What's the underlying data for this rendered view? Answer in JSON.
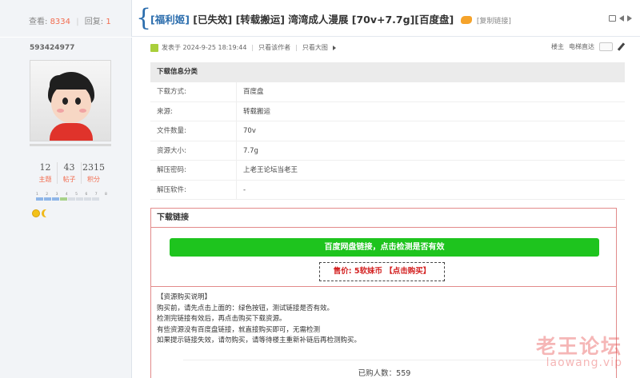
{
  "header": {
    "views_label": "查看:",
    "views_value": "8334",
    "replies_label": "回复:",
    "replies_value": "1",
    "title_tag1": "[福利姬]",
    "title_tag2": "[已失效]",
    "title_tag3": "[转载搬运]",
    "title_main": "湾湾成人漫展 [70v+7.7g][百度盘]",
    "copy_link": "[复制链接]"
  },
  "author": {
    "username": "593424977",
    "stats": [
      {
        "value": "12",
        "label": "主题"
      },
      {
        "value": "43",
        "label": "帖子"
      },
      {
        "value": "2315",
        "label": "积分"
      }
    ],
    "level_numbers": "1 2 3 4 5 6 7 8"
  },
  "post_meta": {
    "posted_at": "发表于 2024-9-25 18:19:44",
    "only_author": "只看该作者",
    "only_large_image": "只看大图",
    "floor": "楼主",
    "e_chat": "电梯直达"
  },
  "info_table": {
    "header": "下载信息分类",
    "rows": [
      {
        "key": "下载方式:",
        "value": "百度盘"
      },
      {
        "key": "来源:",
        "value": "转载搬运"
      },
      {
        "key": "文件数量:",
        "value": "70v"
      },
      {
        "key": "资源大小:",
        "value": "7.7g"
      },
      {
        "key": "解压密码:",
        "value": "上老王论坛当老王"
      },
      {
        "key": "解压软件:",
        "value": "-"
      }
    ]
  },
  "download": {
    "title": "下载链接",
    "check_button": "百度网盘链接，点击检测是否有效",
    "price_label": "售价:",
    "price_value": "5软妹币",
    "buy_label": "【点击购买】",
    "notes": [
      "【资源购买说明】",
      "购买前，请先点击上面的：绿色按钮，测试链接是否有效。",
      "检测完链接有效后，再点击购买下载资源。",
      "有些资源没有百度盘链接，就直接购买即可，无需检测",
      "如果提示链接失效，请勿购买，请等待楼主重新补链后再检测购买。"
    ],
    "buyers": "已购人数：559"
  },
  "watermark": {
    "site_name": "老王论坛",
    "url": "laowang.vip"
  }
}
